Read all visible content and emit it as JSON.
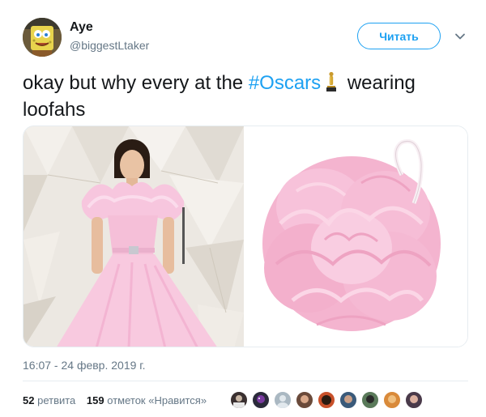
{
  "user": {
    "display_name": "Aye",
    "handle": "@biggestLtaker",
    "avatar_icon": "spongebob-avatar"
  },
  "follow_button": {
    "label": "Читать"
  },
  "tweet": {
    "text_part1": "okay but why every at the ",
    "hashtag": "#Oscars",
    "emoji": "oscar-trophy-icon",
    "text_part2": " wearing loofahs"
  },
  "media": {
    "left_image": "pink-tulle-gown-photo",
    "right_image": "pink-loofah-photo"
  },
  "timestamp": "16:07 - 24 февр. 2019 г.",
  "stats": {
    "retweets_count": "52",
    "retweets_label": "ретвита",
    "likes_count": "159",
    "likes_label": "отметок «Нравится»"
  },
  "colors": {
    "accent": "#1da1f2",
    "text": "#14171a",
    "muted": "#657786"
  }
}
